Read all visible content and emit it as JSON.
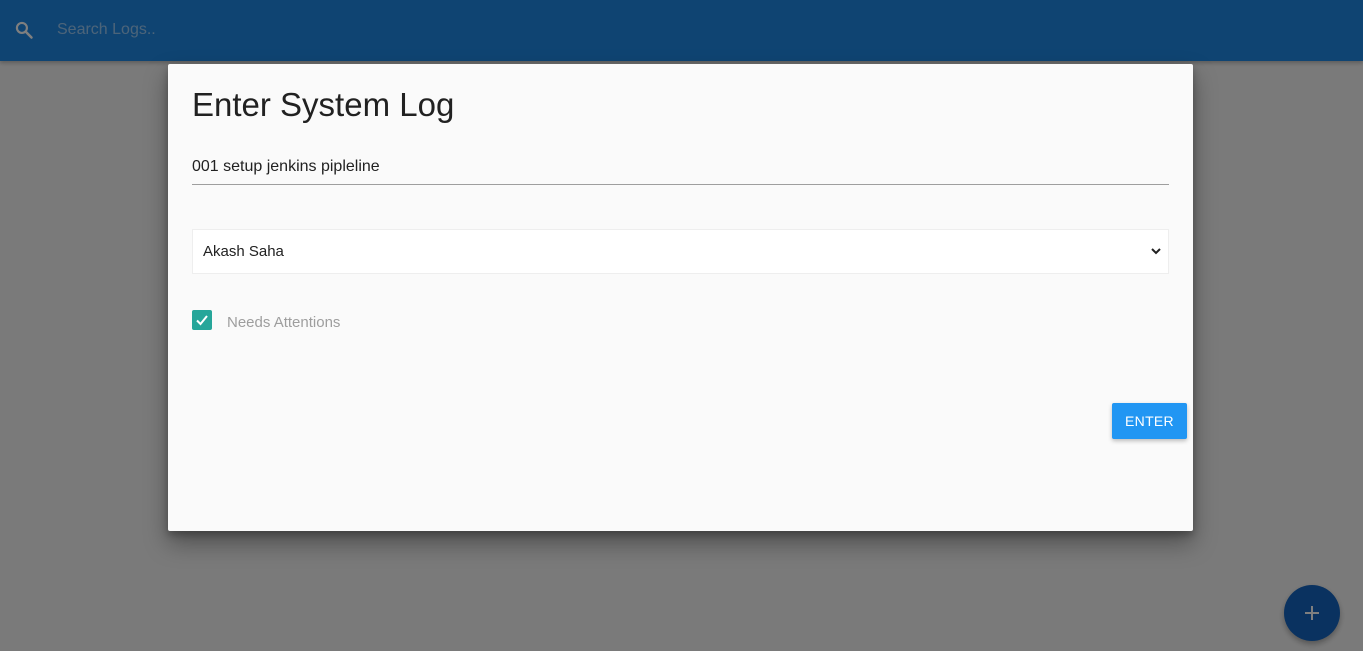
{
  "navbar": {
    "search_icon": "search-icon",
    "search_placeholder": "Search Logs..",
    "color": "#1e88e5"
  },
  "modal": {
    "title": "Enter System Log",
    "message_value": "001 setup jenkins pipleline",
    "technician": {
      "selected": "Akash Saha",
      "icon": "chevron-down-icon"
    },
    "attention": {
      "checked": true,
      "label": "Needs Attentions",
      "color": "#26a69a"
    },
    "submit_label": "ENTER",
    "submit_color": "#2196f3"
  },
  "fab": {
    "icon": "plus-icon",
    "color": "#1565c0"
  }
}
